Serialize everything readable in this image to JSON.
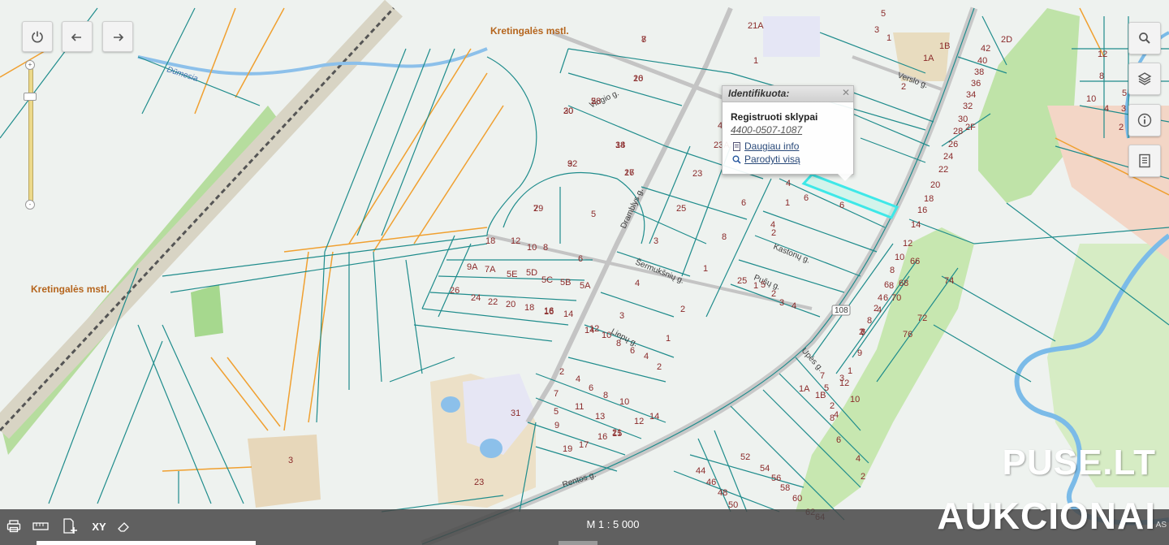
{
  "map": {
    "town_label_top": "Kretingalės mstl.",
    "town_label_left": "Kretingalės mstl.",
    "water_label": "Dūmesia",
    "streets": {
      "vingio": "Vingio g.",
      "dramblys": "Dramblys g.",
      "versio": "Verslo g.",
      "sermuksniu": "Šermukšnių g.",
      "kastonu": "Kastonų g.",
      "pusu": "Pušų g.",
      "liepu": "Liepų g.",
      "upes": "Upės g.",
      "rentos": "Rentos g.",
      "road_number": "108"
    },
    "parcel_numbers": [
      "8",
      "10",
      "5",
      "20",
      "9",
      "18",
      "16",
      "7",
      "5",
      "23",
      "25",
      "3",
      "4",
      "3",
      "1",
      "2",
      "6",
      "8",
      "4",
      "21A",
      "1",
      "1A",
      "1B",
      "5",
      "3",
      "1",
      "2D",
      "2",
      "2F",
      "23A",
      "4",
      "1",
      "4",
      "2",
      "6",
      "6",
      "18",
      "12",
      "10",
      "8",
      "14",
      "16",
      "9A",
      "7A",
      "5E",
      "5D",
      "5C",
      "5B",
      "5A",
      "6",
      "26",
      "24",
      "22",
      "20",
      "18",
      "16",
      "14",
      "12",
      "10",
      "8",
      "6",
      "4",
      "2",
      "1",
      "2",
      "4",
      "6",
      "8",
      "10",
      "12",
      "14",
      "15",
      "16",
      "17",
      "19",
      "21",
      "13",
      "11",
      "9",
      "7",
      "5",
      "3",
      "31",
      "23",
      "25",
      "1",
      "2",
      "3",
      "4",
      "5",
      "7",
      "9",
      "1",
      "3",
      "5",
      "7",
      "12",
      "10",
      "8",
      "6",
      "4",
      "2",
      "1A",
      "1B",
      "2",
      "4",
      "6",
      "8",
      "2",
      "4",
      "6",
      "8",
      "10",
      "12",
      "14",
      "16",
      "18",
      "20",
      "22",
      "24",
      "26",
      "28",
      "30",
      "32",
      "34",
      "36",
      "38",
      "40",
      "42",
      "44",
      "46",
      "48",
      "50",
      "52",
      "54",
      "56",
      "58",
      "60",
      "62",
      "64",
      "66",
      "68",
      "70",
      "72",
      "74",
      "76",
      "2",
      "4",
      "6",
      "8",
      "8",
      "12",
      "10",
      "4",
      "2",
      "3",
      "5",
      "7",
      "26",
      "28",
      "30",
      "32",
      "34",
      "27",
      "29"
    ]
  },
  "controls": {
    "power_icon": "power-icon",
    "back_icon": "back-arrow-icon",
    "forward_icon": "forward-arrow-icon",
    "search_icon": "search-icon",
    "layers_icon": "layers-icon",
    "info_icon": "info-icon",
    "legend_icon": "legend-icon",
    "zoom_plus": "+",
    "zoom_minus": "-"
  },
  "popup": {
    "header": "Identifikuota:",
    "title": "Registruoti sklypai",
    "code": "4400-0507-1087",
    "more_info": "Daugiau info",
    "show_all": "Parodyti visą"
  },
  "bottombar": {
    "scale": "M 1 : 5 000",
    "xy_label": "XY",
    "corner_text": "AS"
  },
  "watermark": {
    "line1": "PUSE.LT",
    "line2": "AUKCIONAI"
  },
  "colors": {
    "parcel": "#1f8c8c",
    "boundary_orange": "#f0a030",
    "road": "#b0b0b0",
    "river": "#5ea8e0",
    "green": "#b5dba0",
    "highlight": "#3ee8e8"
  }
}
